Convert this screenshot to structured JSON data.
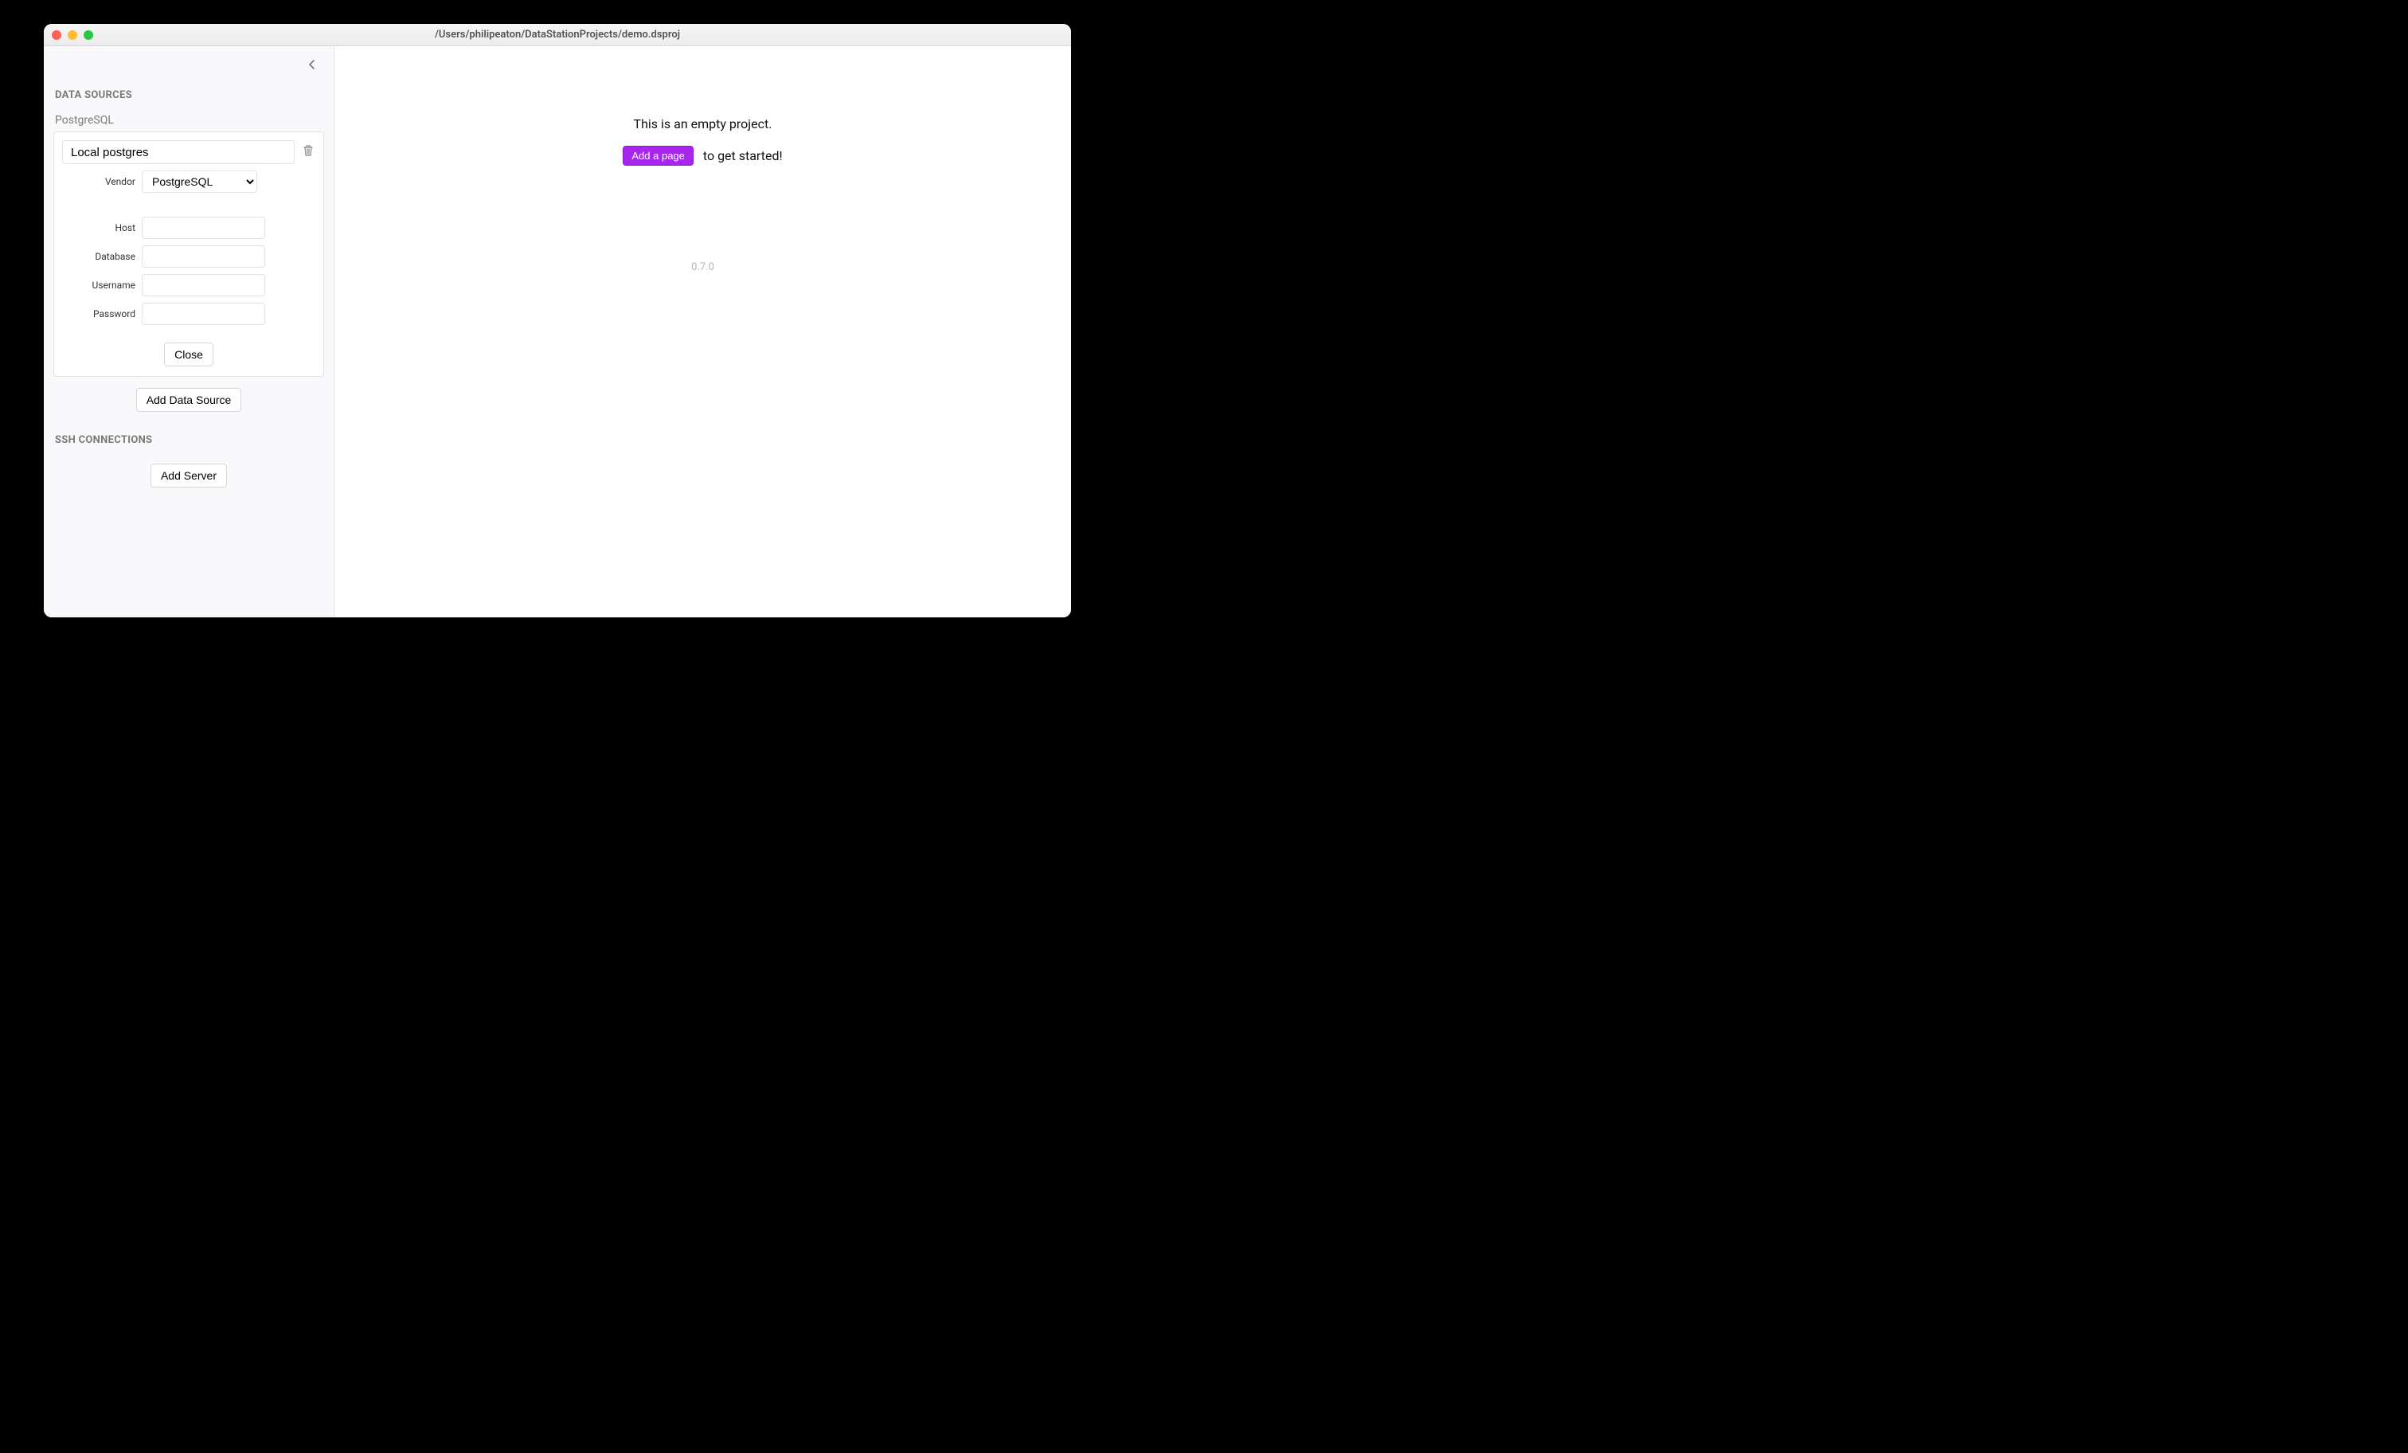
{
  "window": {
    "title": "/Users/philipeaton/DataStationProjects/demo.dsproj"
  },
  "sidebar": {
    "sections": {
      "data_sources": {
        "title": "DATA SOURCES",
        "type_label": "PostgreSQL",
        "item": {
          "name_value": "Local postgres",
          "vendor_label": "Vendor",
          "vendor_value": "PostgreSQL",
          "vendor_options": [
            "PostgreSQL"
          ],
          "fields": {
            "host_label": "Host",
            "host_value": "",
            "database_label": "Database",
            "database_value": "",
            "username_label": "Username",
            "username_value": "",
            "password_label": "Password",
            "password_value": ""
          },
          "close_label": "Close"
        },
        "add_label": "Add Data Source"
      },
      "ssh": {
        "title": "SSH CONNECTIONS",
        "add_label": "Add Server"
      }
    }
  },
  "main": {
    "empty_message": "This is an empty project.",
    "cta_button": "Add a page",
    "cta_suffix": "to get started!",
    "version": "0.7.0"
  }
}
